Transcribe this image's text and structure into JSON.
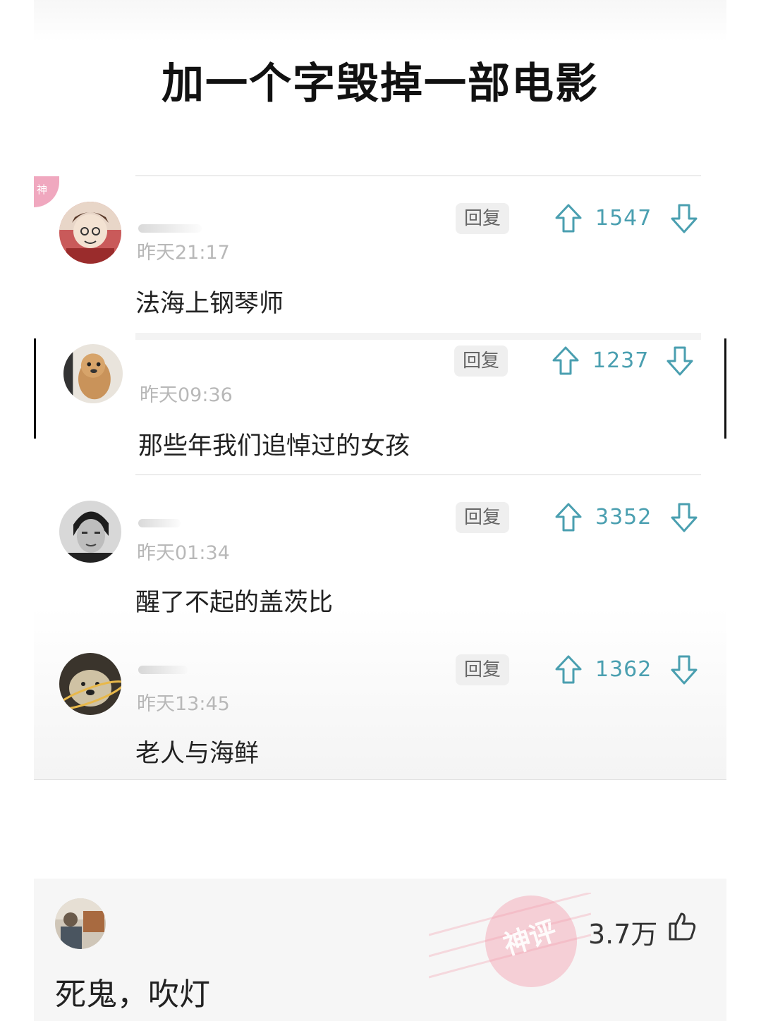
{
  "post": {
    "title": "加一个字毁掉一部电影",
    "badge": "神"
  },
  "comments": [
    {
      "time": "昨天21:17",
      "text": "法海上钢琴师",
      "reply": "回复",
      "likes": "1547"
    },
    {
      "time": "昨天09:36",
      "text": "那些年我们追悼过的女孩",
      "reply": "回复",
      "likes": "1237"
    },
    {
      "time": "昨天01:34",
      "text": "醒了不起的盖茨比",
      "reply": "回复",
      "likes": "3352"
    },
    {
      "time": "昨天13:45",
      "text": "老人与海鲜",
      "reply": "回复",
      "likes": "1362"
    }
  ],
  "bottom_comment": {
    "text": "死鬼，吹灯",
    "likes": "3.7万",
    "stamp": "神评"
  },
  "icons": {
    "upvote": "arrow-up-icon",
    "downvote": "arrow-down-icon",
    "thumb": "thumb-up-icon"
  },
  "colors": {
    "accent": "#4a9fb0",
    "badge": "#f0a8bf",
    "stamp": "#f4a0b0"
  }
}
